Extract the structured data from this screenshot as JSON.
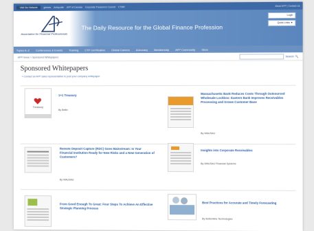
{
  "topbar": {
    "visit": "Visit Our Network",
    "links": [
      "gtnews",
      "Antiquotle",
      "AFP of Canada",
      "Corporate Treasurers Council",
      "CTMR"
    ],
    "right": "About AFP | Contact Us"
  },
  "header": {
    "org_name": "Association for Financial Professionals",
    "tagline": "The Daily Resource for the Global Finance Profession",
    "login_label": "Login",
    "quick_links_label": "Quick Links ▼"
  },
  "nav": {
    "items": [
      "Topics A–Z",
      "Conferences & Events",
      "Training",
      "CTP Certification",
      "Global Careers",
      "Advocacy",
      "Membership",
      "AFP Community",
      "Store"
    ]
  },
  "breadcrumb": "AFP Home > Sponsored Whitepapers",
  "search": {
    "placeholder": "",
    "button_label": "Search"
  },
  "page_title": "Sponsored Whitepapers",
  "contact_link": "» Contact an AFP sales representative to post your company whitepaper",
  "whitepapers": [
    {
      "title": "1+1 Treasury",
      "by": "By Bellin"
    },
    {
      "title": "Massachusetts Bank Reduces Costs Through Outsourced Wholesale Lockbox: Eastern Bank Improves Receivables Processing and Grows Customer Base",
      "by": "By WAUSAU"
    },
    {
      "title": "Remote Deposit Capture (RDC) Goes Mainstream: Is Your Financial Institution Ready for New Risks and a New Generation of Customers?",
      "by": "By WAUSAU"
    },
    {
      "title": "Insights into Corporate Receivables",
      "by": "By WAUSAU Financial Systems"
    },
    {
      "title": "From Good Enough To Great: Four Steps To Achieve An Effective Strategic Planning Process",
      "by": ""
    },
    {
      "title": "Best Practices for Accurate and Timely Forecasting",
      "by": "By Bottomline Technologies"
    }
  ],
  "thumb_labels": {
    "treasury": "Treasury"
  },
  "colors": {
    "accent_blue": "#3d6aa6",
    "nav_blue": "#6b90c2",
    "link_blue": "#2a5ea5",
    "thumb_orange": "#e89a2c"
  }
}
